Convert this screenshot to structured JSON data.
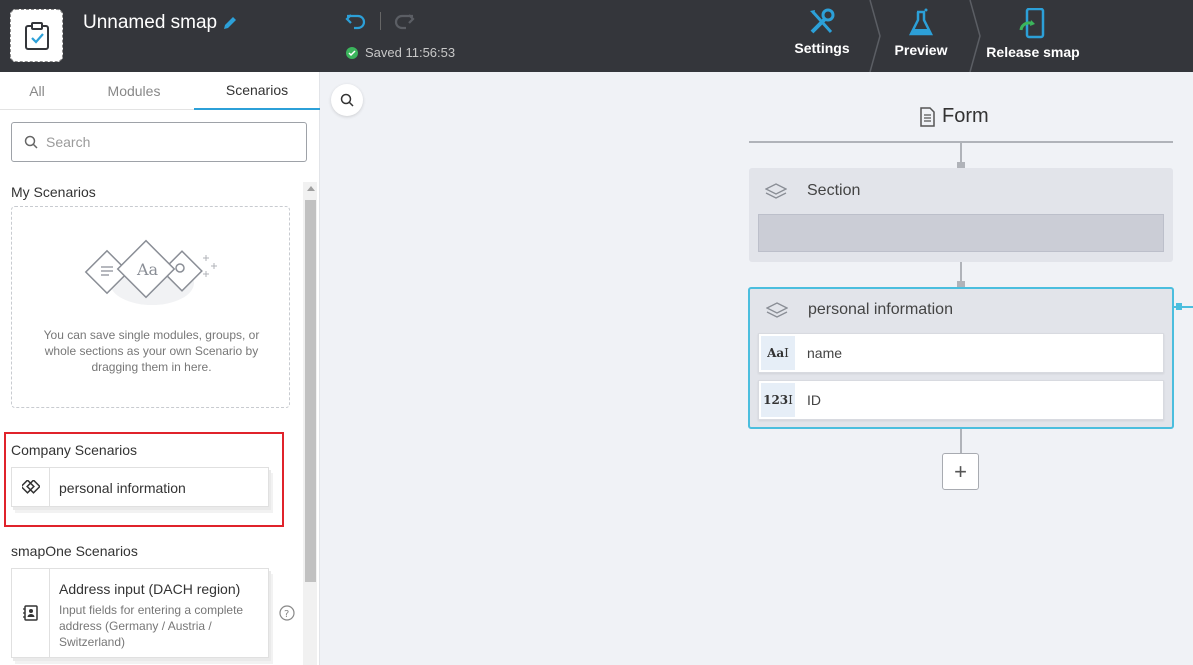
{
  "header": {
    "app_name": "Unnamed smap",
    "saved_status": "Saved 11:56:53",
    "actions": [
      {
        "label": "Settings",
        "icon": "tools-icon"
      },
      {
        "label": "Preview",
        "icon": "flask-icon"
      },
      {
        "label": "Release smap",
        "icon": "phone-release-icon"
      }
    ],
    "accent_color": "#2ca0d8"
  },
  "sidebar": {
    "tabs": [
      {
        "label": "All",
        "active": false
      },
      {
        "label": "Modules",
        "active": false
      },
      {
        "label": "Scenarios",
        "active": true
      }
    ],
    "search_placeholder": "Search",
    "my_scenarios": {
      "title": "My Scenarios",
      "hint": "You can save single modules, groups, or whole sections as your own Scenario by dragging them in here."
    },
    "company_scenarios": {
      "title": "Company Scenarios",
      "items": [
        {
          "label": "personal information",
          "icon": "scenario-icon"
        }
      ]
    },
    "smapone_scenarios": {
      "title": "smapOne Scenarios",
      "items": [
        {
          "label": "Address input (DACH region)",
          "description": "Input fields for entering a complete address (Germany / Austria / Switzerland)",
          "icon": "address-card-icon"
        }
      ]
    }
  },
  "canvas": {
    "form_title": "Form",
    "section": {
      "title": "Section"
    },
    "group": {
      "title": "personal information",
      "fields": [
        {
          "label": "name",
          "icon_text": "Aa",
          "icon": "text-field-icon"
        },
        {
          "label": "ID",
          "icon_text": "123",
          "icon": "number-field-icon"
        }
      ]
    },
    "add_label": "+"
  }
}
